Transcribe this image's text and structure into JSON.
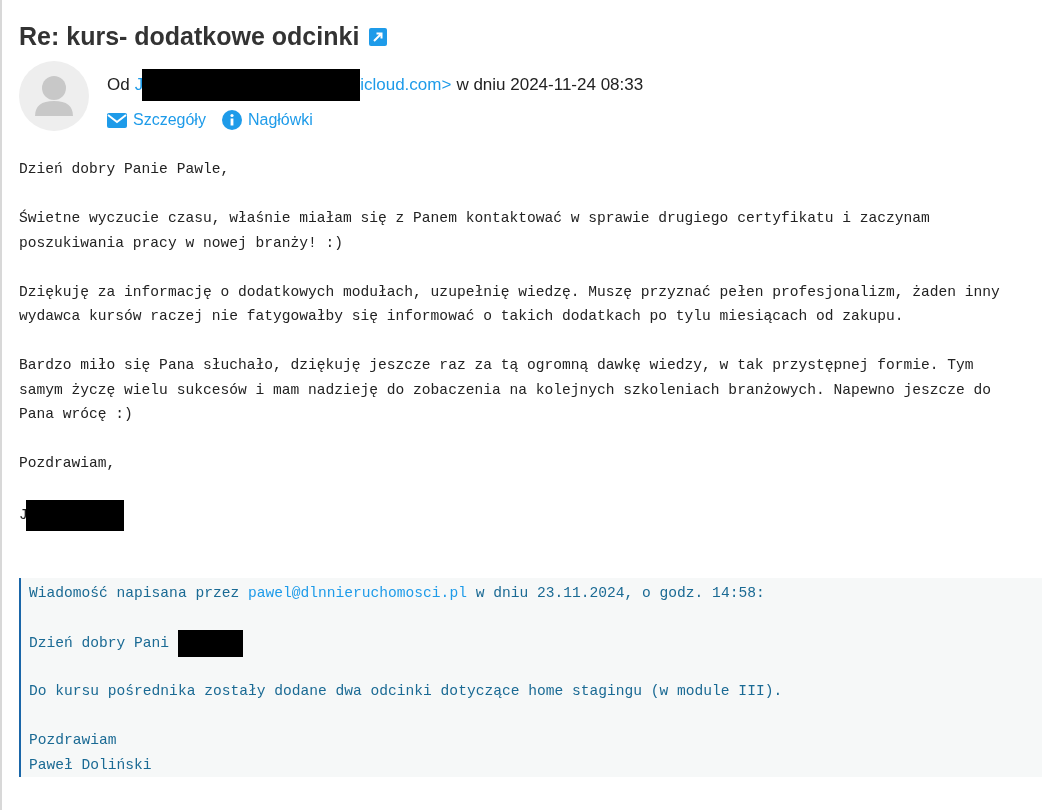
{
  "subject": "Re: kurs- dodatkowe odcinki",
  "header": {
    "from_label": "Od",
    "sender_start": "J",
    "sender_end": "icloud.com>",
    "date_text": "w dniu 2024-11-24 08:33",
    "links": [
      {
        "label": "Szczegóły",
        "kind": "mail"
      },
      {
        "label": "Nagłówki",
        "kind": "info"
      }
    ]
  },
  "body": [
    {
      "lines": [
        "Dzień dobry Panie Pawle,"
      ]
    },
    {
      "lines": [
        "Świetne wyczucie czasu, właśnie miałam się z Panem kontaktować w sprawie drugiego certyfikatu i zaczynam",
        "poszukiwania pracy w nowej branży! :)"
      ]
    },
    {
      "lines": [
        "Dziękuję za informację o dodatkowych modułach, uzupełnię wiedzę. Muszę przyznać pełen profesjonalizm, żaden inny",
        "wydawca kursów raczej nie fatygowałby się informować o takich dodatkach po tylu miesiącach od zakupu."
      ]
    },
    {
      "lines": [
        "Bardzo miło się Pana słuchało, dziękuję jeszcze raz za tą ogromną dawkę wiedzy, w tak przystępnej formie. Tym",
        "samym życzę wielu sukcesów i mam nadzieję do zobaczenia na kolejnych szkoleniach branżowych. Napewno jeszcze do",
        "Pana wrócę :)"
      ]
    },
    {
      "lines": [
        "Pozdrawiam,"
      ]
    }
  ],
  "signature": "J",
  "quote": {
    "intro_before": "Wiadomość napisana przez",
    "intro_link": "pawel@dlnnieruchomosci.pl",
    "intro_after": "w dniu 23.11.2024, o godz. 14:58:",
    "greeting": "Dzień dobry Pani",
    "paragraph": "Do kursu pośrednika zostały dodane dwa odcinki dotyczące home stagingu (w module III).",
    "closing": [
      "Pozdrawiam",
      "Paweł Doliński"
    ]
  }
}
